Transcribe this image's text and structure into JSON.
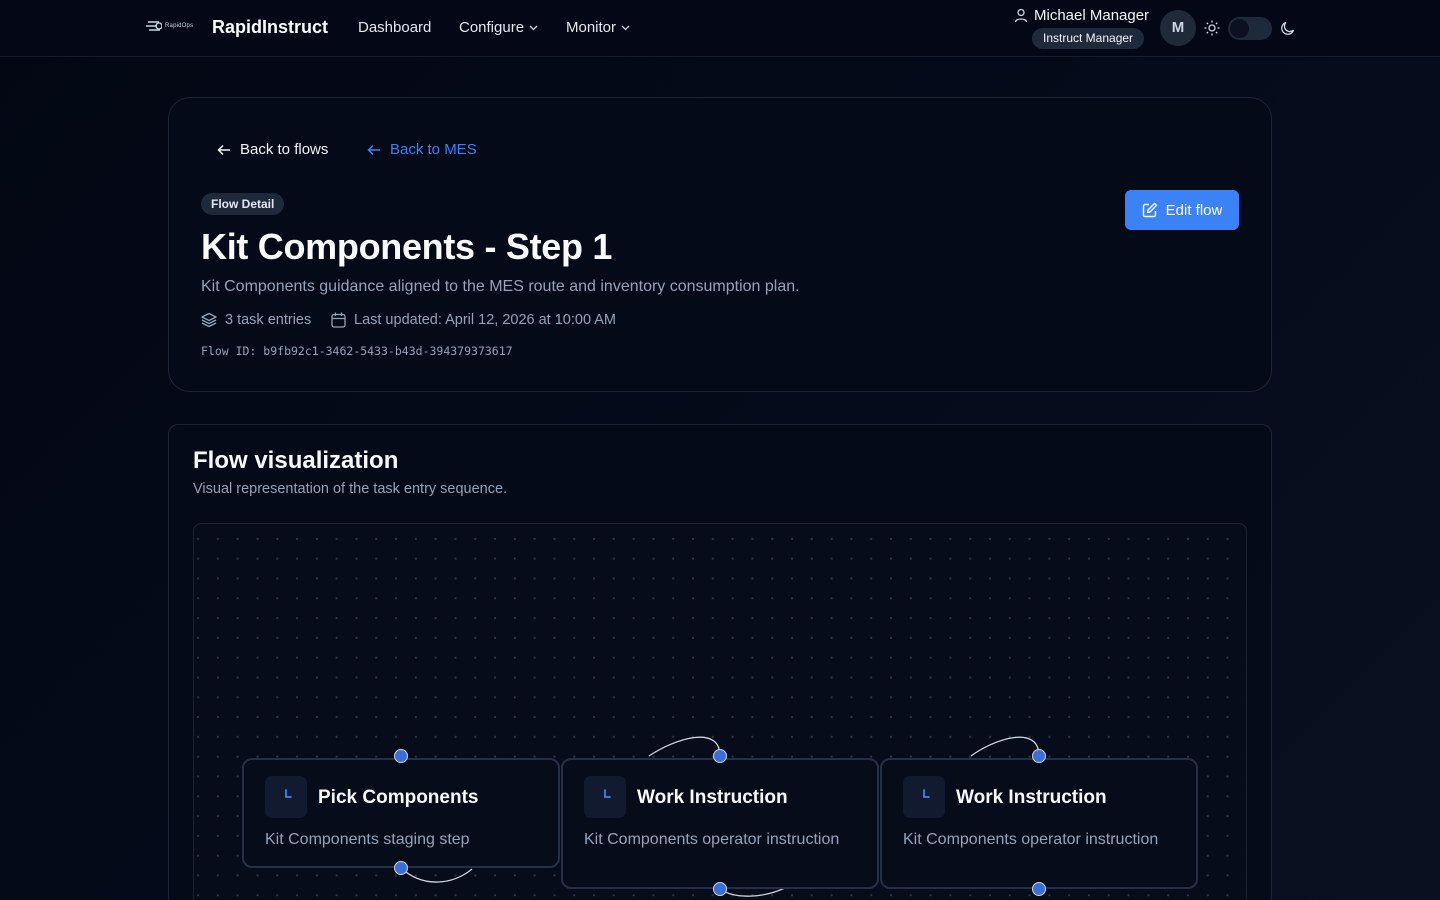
{
  "header": {
    "logo_text": "RapidOps",
    "brand": "RapidInstruct",
    "nav": [
      {
        "label": "Dashboard",
        "icon": ""
      },
      {
        "label": "Configure",
        "icon": "chevron-down-icon"
      },
      {
        "label": "Monitor",
        "icon": "chevron-down-icon"
      }
    ],
    "user_name": "Michael Manager",
    "user_role": "Instruct Manager",
    "avatar_initial": "M",
    "theme": "dark"
  },
  "page": {
    "back_to_flows": "Back to flows",
    "back_to_mes": "Back to MES",
    "badge": "Flow Detail",
    "title": "Kit Components - Step 1",
    "description": "Kit Components guidance aligned to the MES route and inventory consumption plan.",
    "task_entries": "3 task entries",
    "last_updated": "Last updated: April 12, 2026 at 10:00 AM",
    "flow_id": "Flow ID: b9fb92c1-3462-5433-b43d-394379373617",
    "edit_label": "Edit flow"
  },
  "visualization": {
    "title": "Flow visualization",
    "subtitle": "Visual representation of the task entry sequence.",
    "nodes": [
      {
        "title": "Pick Components",
        "description": "Kit Components staging step",
        "icon": "clock-icon"
      },
      {
        "title": "Work Instruction",
        "description": "Kit Components operator instruction",
        "icon": "clock-icon"
      },
      {
        "title": "Work Instruction",
        "description": "Kit Components operator instruction",
        "icon": "clock-icon"
      }
    ]
  },
  "colors": {
    "accent": "#3b82f6",
    "background": "#040816",
    "card_border": "#1c2434",
    "muted_text": "#94a3b8"
  }
}
